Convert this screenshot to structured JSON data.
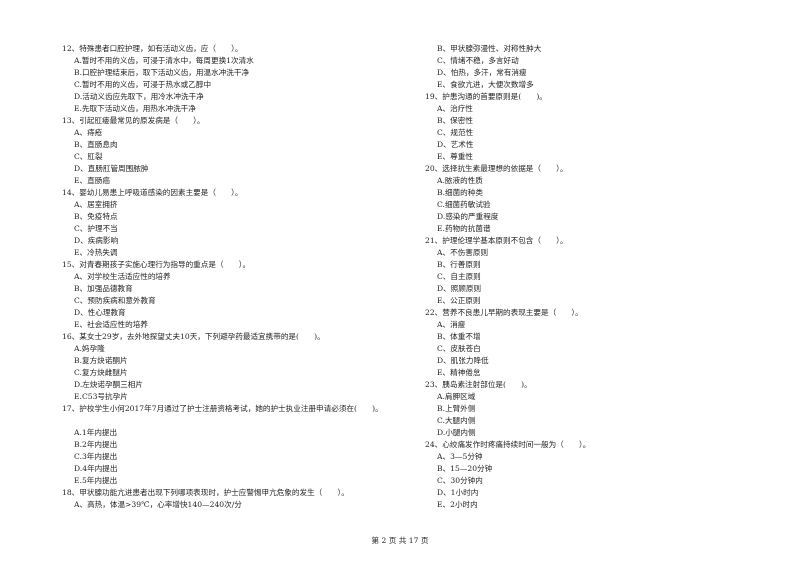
{
  "left_column": [
    {
      "t": "q",
      "text": "12、特殊患者口腔护理，如有活动义齿，应（　　）。"
    },
    {
      "t": "o",
      "text": "A.暂时不用的义齿，可浸于清水中，每周更换1次清水"
    },
    {
      "t": "o",
      "text": "B.口腔护理结束后，取下活动义齿，用温水冲洗干净"
    },
    {
      "t": "o",
      "text": "C.暂时不用的义齿，可浸于热水或乙醇中"
    },
    {
      "t": "o",
      "text": "D.活动义齿应先取下，用冷水冲洗干净"
    },
    {
      "t": "o",
      "text": "E.先取下活动义齿，用热水冲洗干净"
    },
    {
      "t": "q",
      "text": "13、引起肛瘘最常见的原发病是（　　）。"
    },
    {
      "t": "o",
      "text": "A、痔疮"
    },
    {
      "t": "o",
      "text": "B、直肠息肉"
    },
    {
      "t": "o",
      "text": "C、肛裂"
    },
    {
      "t": "o",
      "text": "D、直肠肛管周围脓肿"
    },
    {
      "t": "o",
      "text": "E、直肠癌"
    },
    {
      "t": "q",
      "text": "14、婴幼儿易患上呼吸道感染的因素主要是（　　）。"
    },
    {
      "t": "o",
      "text": "A、居室拥挤"
    },
    {
      "t": "o",
      "text": "B、免疫特点"
    },
    {
      "t": "o",
      "text": "C、护理不当"
    },
    {
      "t": "o",
      "text": "D、疾病影响"
    },
    {
      "t": "o",
      "text": "E、冷热失调"
    },
    {
      "t": "q",
      "text": "15、对青春期孩子实施心理行为指导的重点是（　　）。"
    },
    {
      "t": "o",
      "text": "A、对学校生活适应性的培养"
    },
    {
      "t": "o",
      "text": "B、加强品德教育"
    },
    {
      "t": "o",
      "text": "C、预防疾病和意外教育"
    },
    {
      "t": "o",
      "text": "D、性心理教育"
    },
    {
      "t": "o",
      "text": "E、社会适应性的培养"
    },
    {
      "t": "q",
      "text": "16、某女士29岁，去外地探望丈夫10天，下列避孕药最适宜携带的是(　　)。"
    },
    {
      "t": "o",
      "text": "A.妈孕隆"
    },
    {
      "t": "o",
      "text": "B.复方炔诺酮片"
    },
    {
      "t": "o",
      "text": "C.复方炔雌醚片"
    },
    {
      "t": "o",
      "text": "D.左炔诺孕酮三相片"
    },
    {
      "t": "o",
      "text": "E.C53号抗孕片"
    },
    {
      "t": "q",
      "text": "17、护校学生小何2017年7月通过了护士注册资格考试，她的护士执业注册申请必须在(　　)。"
    },
    {
      "t": "b",
      "text": ""
    },
    {
      "t": "o",
      "text": "A.1年内提出"
    },
    {
      "t": "o",
      "text": "B.2年内提出"
    },
    {
      "t": "o",
      "text": "C.3年内提出"
    },
    {
      "t": "o",
      "text": "D.4年内提出"
    },
    {
      "t": "o",
      "text": "E.5年内提出"
    },
    {
      "t": "q",
      "text": "18、甲状腺功能亢进患者出现下列哪项表现时，护士应警惕甲亢危象的发生（　　）。"
    },
    {
      "t": "o",
      "text": "A、高热，体温>39℃，心率增快140—240次/分"
    }
  ],
  "right_column": [
    {
      "t": "o",
      "text": "B、甲状腺弥漫性、对称性肿大"
    },
    {
      "t": "o",
      "text": "C、情绪不稳，多言好动"
    },
    {
      "t": "o",
      "text": "D、怕热，多汗，常有消瘦"
    },
    {
      "t": "o",
      "text": "E、食欲亢进，大便次数增多"
    },
    {
      "t": "q",
      "text": "19、护患沟通的首要原则是(　　)。"
    },
    {
      "t": "o",
      "text": "A、治疗性"
    },
    {
      "t": "o",
      "text": "B、保密性"
    },
    {
      "t": "o",
      "text": "C、规范性"
    },
    {
      "t": "o",
      "text": "D、艺术性"
    },
    {
      "t": "o",
      "text": "E、尊重性"
    },
    {
      "t": "q",
      "text": "20、选择抗生素最理想的依据是（　　）。"
    },
    {
      "t": "o",
      "text": "A.脓液的性质"
    },
    {
      "t": "o",
      "text": "B.细菌的种类"
    },
    {
      "t": "o",
      "text": "C.细菌药敏试验"
    },
    {
      "t": "o",
      "text": "D.感染的严重程度"
    },
    {
      "t": "o",
      "text": "E.药物的抗菌谱"
    },
    {
      "t": "q",
      "text": "21、护理伦理学基本原则不包含（　　）。"
    },
    {
      "t": "o",
      "text": "A、不伤害原则"
    },
    {
      "t": "o",
      "text": "B、行善原则"
    },
    {
      "t": "o",
      "text": "C、自主原则"
    },
    {
      "t": "o",
      "text": "D、照顾原则"
    },
    {
      "t": "o",
      "text": "E、公正原则"
    },
    {
      "t": "q",
      "text": "22、营养不良患儿早期的表现主要是（　　）。"
    },
    {
      "t": "o",
      "text": "A、消瘦"
    },
    {
      "t": "o",
      "text": "B、体重不增"
    },
    {
      "t": "o",
      "text": "C、皮肤苍白"
    },
    {
      "t": "o",
      "text": "D、肌张力降低"
    },
    {
      "t": "o",
      "text": "E、精神倦怠"
    },
    {
      "t": "q",
      "text": "23、胰岛素注射部位是(　　)。"
    },
    {
      "t": "o",
      "text": "A.肩胛区域"
    },
    {
      "t": "o",
      "text": "B.上臂外侧"
    },
    {
      "t": "o",
      "text": "C.大腿内侧"
    },
    {
      "t": "o",
      "text": "D.小腿内侧"
    },
    {
      "t": "q",
      "text": "24、心绞痛发作时疼痛持续时间一般为（　　）。"
    },
    {
      "t": "o",
      "text": "A、3—5分钟"
    },
    {
      "t": "o",
      "text": "B、15—20分钟"
    },
    {
      "t": "o",
      "text": "C、30分钟内"
    },
    {
      "t": "o",
      "text": "D、1小时内"
    },
    {
      "t": "o",
      "text": "E、2小时内"
    }
  ],
  "footer": {
    "page_label": "第 2 页 共 17 页"
  }
}
